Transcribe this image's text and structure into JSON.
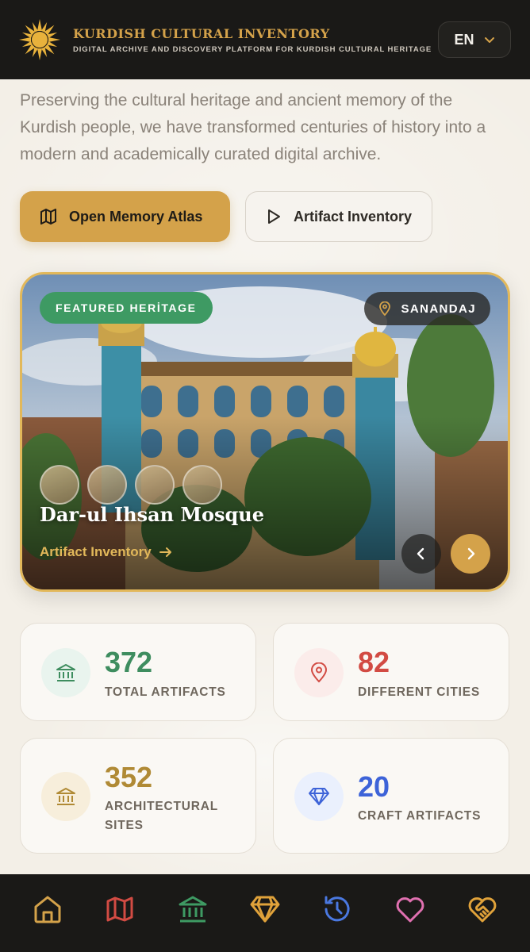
{
  "header": {
    "title": "KURDISH CULTURAL INVENTORY",
    "subtitle": "DIGITAL ARCHIVE AND DISCOVERY PLATFORM FOR KURDISH CULTURAL HERITAGE",
    "language": "EN",
    "logo_icon": "sun-emblem-icon"
  },
  "intro": {
    "text": "Preserving the cultural heritage and ancient memory of the Kurdish people, we have transformed centuries of history into a modern and academically curated digital archive."
  },
  "actions": {
    "primary_label": "Open Memory Atlas",
    "primary_icon": "map-icon",
    "secondary_label": "Artifact Inventory",
    "secondary_icon": "play-icon"
  },
  "featured": {
    "badge": "FEATURED HERİTAGE",
    "city": "SANANDAJ",
    "title": "Dar-ul Ihsan Mosque",
    "link_label": "Artifact Inventory"
  },
  "stats": [
    {
      "value": "372",
      "label": "TOTAL ARTIFACTS",
      "icon": "museum-icon",
      "color": "#3e8d5f"
    },
    {
      "value": "82",
      "label": "DIFFERENT CITIES",
      "icon": "location-pin-icon",
      "color": "#d24b43"
    },
    {
      "value": "352",
      "label": "ARCHITECTURAL SITES",
      "icon": "museum-icon",
      "color": "#b08a35"
    },
    {
      "value": "20",
      "label": "CRAFT ARTIFACTS",
      "icon": "diamond-icon",
      "color": "#3d63d8"
    }
  ],
  "bottom_nav": [
    {
      "icon": "home-icon",
      "color": "#d4a24a"
    },
    {
      "icon": "map-icon",
      "color": "#d24b43"
    },
    {
      "icon": "museum-icon",
      "color": "#3e9a63"
    },
    {
      "icon": "diamond-icon",
      "color": "#e0a23a"
    },
    {
      "icon": "history-icon",
      "color": "#4a78e0"
    },
    {
      "icon": "heart-icon",
      "color": "#e070b0"
    },
    {
      "icon": "heart-handshake-icon",
      "color": "#e0a23a"
    }
  ]
}
